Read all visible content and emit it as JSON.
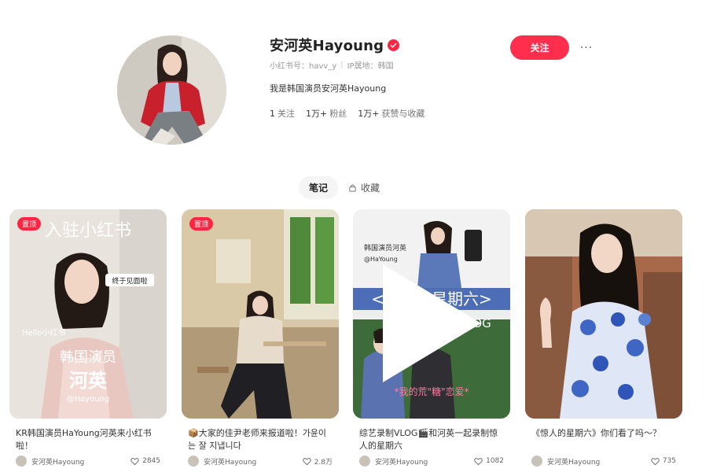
{
  "profile": {
    "name": "安河英Hayoung",
    "account_id": "小红书号：havv_y",
    "ip_location": "IP属地：韩国",
    "bio": "我是韩国演员安河英Hayoung",
    "stats": [
      {
        "num": "1",
        "label": "关注"
      },
      {
        "num": "1万+",
        "label": "粉丝"
      },
      {
        "num": "1万+",
        "label": "获赞与收藏"
      }
    ],
    "follow_label": "关注",
    "more_label": "···"
  },
  "tabs": [
    {
      "label": "笔记",
      "active": true
    },
    {
      "label": "收藏",
      "active": false
    }
  ],
  "notes": [
    {
      "pin": "置顶",
      "cover_text": [
        "入驻小红书",
        "终于见面啦",
        "Hello小红书",
        "韩国演员",
        "河英",
        "@Hayoung"
      ],
      "title": "KR韩国演员HaYoung河英来小红书啦！",
      "author": "安河英Hayoung",
      "likes": "2845"
    },
    {
      "pin": "置顶",
      "cover_text": [],
      "title": "📦大家的佳尹老师来报道啦！가윤이는 잘 지냅니다",
      "author": "安河英Hayoung",
      "likes": "2.8万"
    },
    {
      "pin": "",
      "cover_text": [
        "韩国演员河英",
        "@HaYoung",
        "<惊人的星期六>",
        "录制VLOG",
        "*我的荒\"糖\"恋爱*"
      ],
      "title": "综艺录制VLOG🎬和河英一起录制惊人的星期六",
      "author": "安河英Hayoung",
      "likes": "1082"
    },
    {
      "pin": "",
      "cover_text": [],
      "title": "《惊人的星期六》你们看了吗～？",
      "author": "安河英Hayoung",
      "likes": "735"
    }
  ],
  "colors": {
    "brand_red": "#ff2442",
    "follow_button": "#ff2e4d",
    "text_primary": "#222222",
    "text_muted": "#999999"
  },
  "icons": [
    "verified-badge-icon",
    "more-icon",
    "lock-icon",
    "play-icon",
    "heart-icon"
  ]
}
